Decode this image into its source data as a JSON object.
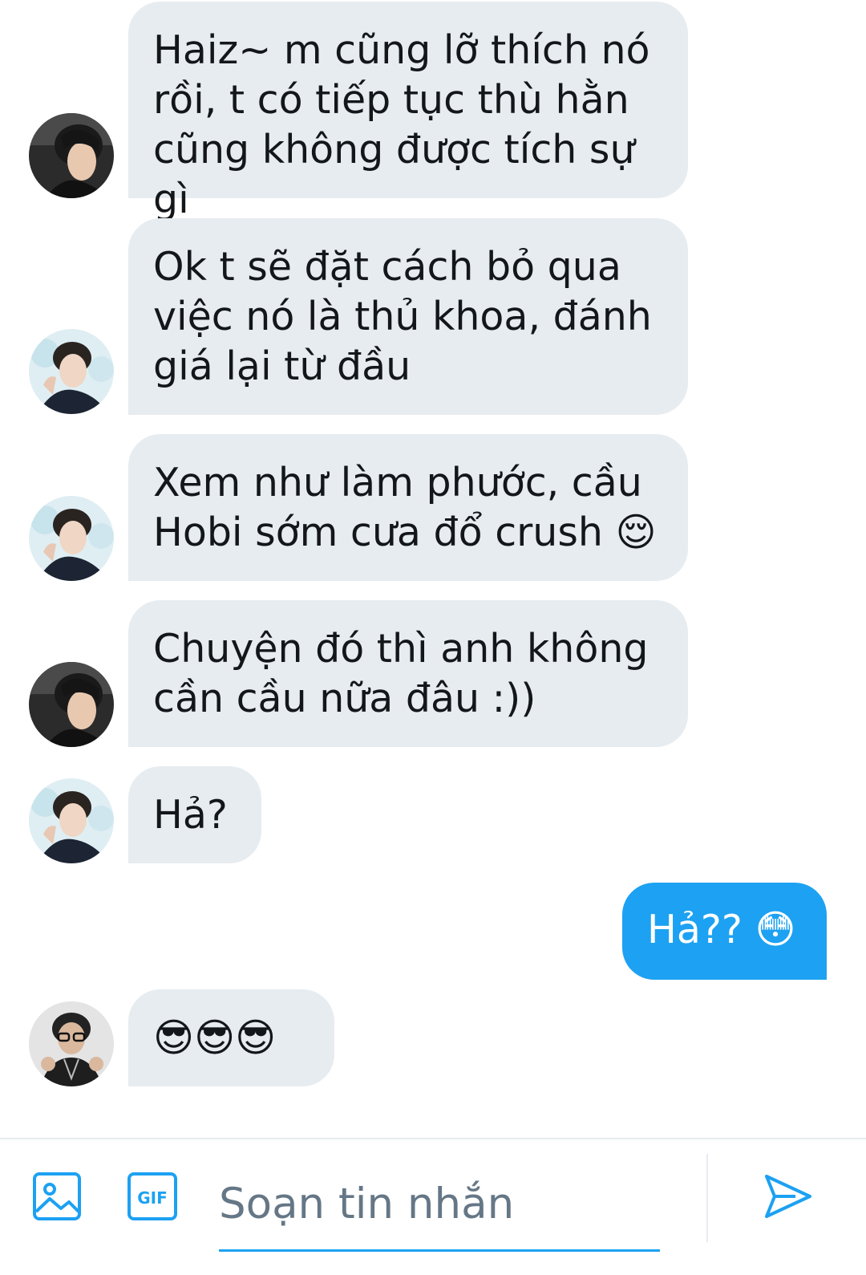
{
  "messages": [
    {
      "direction": "in",
      "avatar": "avatar-dark-hair-man",
      "text": "Haiz~ m cũng lỡ thích nó\nrồi, t có tiếp tục thù hằn\ncũng không được tích sự gì"
    },
    {
      "direction": "in",
      "avatar": "avatar-light-bg-man",
      "text": "Ok t sẽ đặt cách bỏ qua\nviệc nó là thủ khoa, đánh\ngiá lại từ đầu"
    },
    {
      "direction": "in",
      "avatar": "avatar-light-bg-man",
      "text": "Xem như làm phước, cầu\nHobi sớm cưa đổ crush 😌"
    },
    {
      "direction": "in",
      "avatar": "avatar-dark-hair-man",
      "text": "Chuyện đó thì anh không\ncần cầu nữa đâu :))"
    },
    {
      "direction": "in",
      "avatar": "avatar-light-bg-man",
      "text": "Hả?"
    },
    {
      "direction": "out",
      "text": "Hả?? 😳"
    },
    {
      "direction": "in",
      "avatar": "avatar-glasses-man",
      "text": "😎😎😎"
    }
  ],
  "composer": {
    "placeholder": "Soạn tin nhắn",
    "gif_label": "GIF",
    "icons": [
      "image-icon",
      "gif-icon",
      "send-icon"
    ]
  },
  "colors": {
    "incoming_bubble": "#e6ecf0",
    "outgoing_bubble": "#1da1f2",
    "accent": "#1da1f2"
  }
}
